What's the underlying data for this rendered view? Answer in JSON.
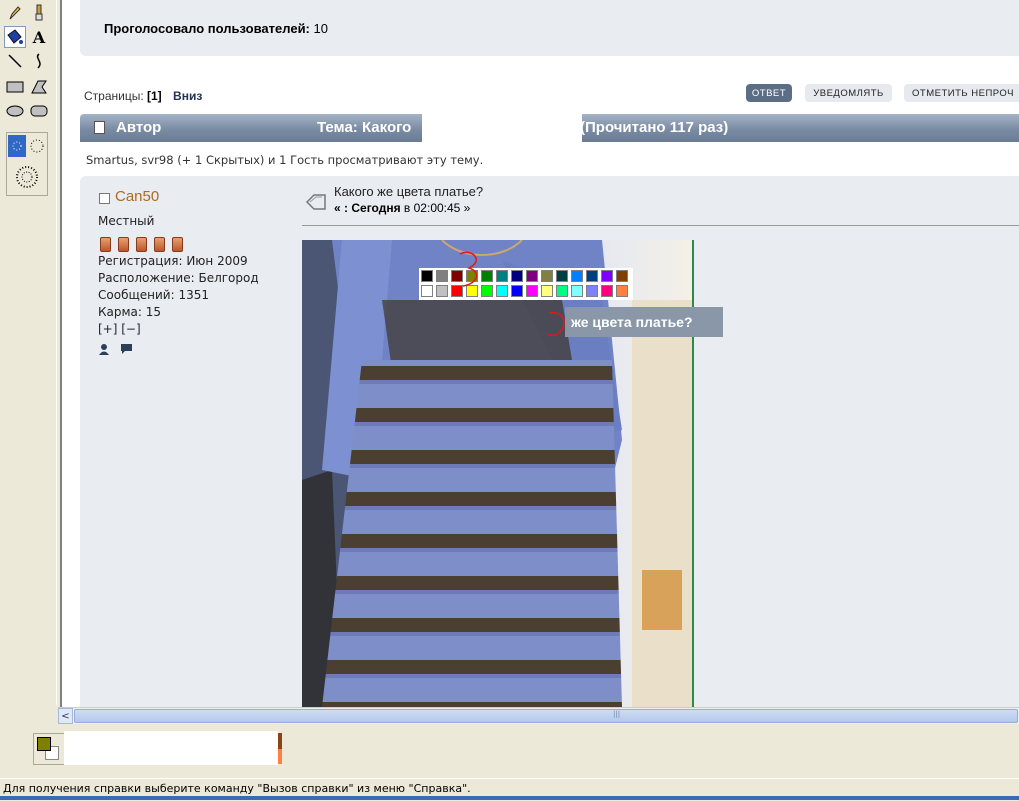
{
  "app": {
    "status_text": "Для получения справки выберите команду \"Вызов справки\" из меню \"Справка\".",
    "toolbox": {
      "tools": [
        "pencil-tool",
        "brush-tool",
        "fill-tool",
        "text-tool",
        "line-tool",
        "curve-tool",
        "rectangle-tool",
        "polygon-tool",
        "ellipse-tool",
        "rounded-rect-tool"
      ],
      "selected": "fill-tool",
      "icons": {
        "fill": "▲",
        "text": "A"
      }
    },
    "colors": {
      "foreground": "#808000",
      "background": "#ffffff",
      "accent_brown": "#8b4513",
      "accent_orange": "#ff8040"
    },
    "scroll": {
      "left_arrow": "<",
      "grip": "|||"
    }
  },
  "page": {
    "poll": {
      "label": "Проголосовало пользователей:",
      "count": "10"
    },
    "pages": {
      "label": "Страницы:",
      "current": "[1]",
      "down": "Вниз"
    },
    "buttons": {
      "reply": "ОТВЕТ",
      "notify": "УВЕДОМЛЯТЬ",
      "mark_unread": "ОТМЕТИТЬ НЕПРОЧ"
    },
    "header": {
      "author": "Автор",
      "topic": "Тема: Какого",
      "read": "(Прочитано 117 раз)"
    },
    "viewers": "Smartus, svr98 (+ 1 Скрытых) и 1 Гость просматривают эту тему.",
    "poster": {
      "name": "Can50",
      "rank": "Местный",
      "stars": 5,
      "registration": "Регистрация: Июн 2009",
      "location": "Расположение: Белгород",
      "messages": "Сообщений: 1351",
      "karma": "Карма: 15",
      "karma_plus": "[+]",
      "karma_minus": "[−]"
    },
    "post": {
      "title": "Какого же цвета платье?",
      "date_prefix": "« :",
      "date_day": "Сегодня",
      "date_rest": "в 02:00:45 »",
      "caption": "же цвета платье?"
    },
    "palette": {
      "row1": [
        "#000000",
        "#808080",
        "#800000",
        "#808000",
        "#008000",
        "#008080",
        "#000080",
        "#800080",
        "#808040",
        "#004040",
        "#0080ff",
        "#004080",
        "#8000ff",
        "#804000"
      ],
      "row2": [
        "#ffffff",
        "#c0c0c0",
        "#ff0000",
        "#ffff00",
        "#00ff00",
        "#00ffff",
        "#0000ff",
        "#ff00ff",
        "#ffff80",
        "#00ff80",
        "#80ffff",
        "#8080ff",
        "#ff0080",
        "#ff8040"
      ]
    }
  }
}
